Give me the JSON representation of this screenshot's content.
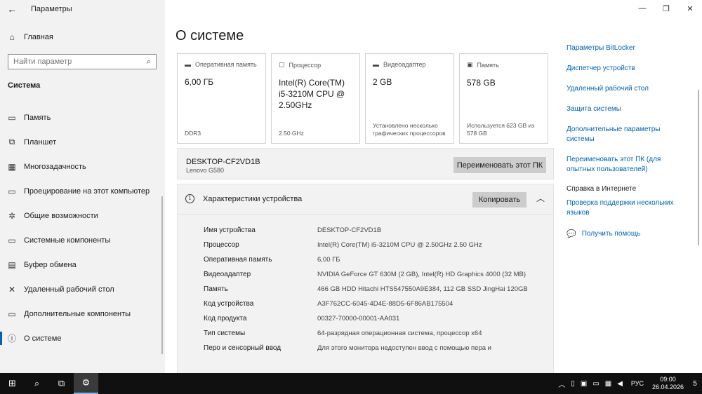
{
  "window": {
    "title": "Параметры",
    "back_icon": "←",
    "minimize_icon": "—",
    "maximize_icon": "❐",
    "close_icon": "✕"
  },
  "sidebar": {
    "home_label": "Главная",
    "search_placeholder": "Найти параметр",
    "section_title": "Система",
    "items": [
      {
        "label": "Память",
        "icon": "▭"
      },
      {
        "label": "Планшет",
        "icon": "⧉"
      },
      {
        "label": "Многозадачность",
        "icon": "▦"
      },
      {
        "label": "Проецирование на этот компьютер",
        "icon": "▭"
      },
      {
        "label": "Общие возможности",
        "icon": "✲"
      },
      {
        "label": "Системные компоненты",
        "icon": "▭"
      },
      {
        "label": "Буфер обмена",
        "icon": "▤"
      },
      {
        "label": "Удаленный рабочий стол",
        "icon": "✕"
      },
      {
        "label": "Дополнительные компоненты",
        "icon": "▭"
      },
      {
        "label": "О системе",
        "icon": "ⓘ"
      }
    ]
  },
  "main": {
    "title": "О системе",
    "cards": [
      {
        "title": "Оперативная память",
        "value": "6,00 ГБ",
        "footer": "DDR3",
        "icon": "▬"
      },
      {
        "title": "Процессор",
        "value": "Intel(R) Core(TM) i5-3210M CPU @ 2.50GHz",
        "footer": "2.50 GHz",
        "icon": "▢"
      },
      {
        "title": "Видеоадаптер",
        "value": "2 GB",
        "footer": "Установлено несколько графических процессоров",
        "icon": "▬"
      },
      {
        "title": "Память",
        "value": "578 GB",
        "footer": "Используется 623 GB из 578 GB",
        "icon": "▣"
      }
    ],
    "device": {
      "name": "DESKTOP-CF2VD1B",
      "model": "Lenovo G580",
      "rename_label": "Переименовать этот ПК"
    },
    "specs": {
      "title": "Характеристики устройства",
      "copy_label": "Копировать",
      "info_icon": "i",
      "chevron_icon": "︿",
      "rows": [
        {
          "label": "Имя устройства",
          "value": "DESKTOP-CF2VD1B"
        },
        {
          "label": "Процессор",
          "value": "Intel(R) Core(TM) i5-3210M CPU @ 2.50GHz   2.50 GHz"
        },
        {
          "label": "Оперативная память",
          "value": "6,00 ГБ"
        },
        {
          "label": "Видеоадаптер",
          "value": "NVIDIA GeForce GT 630M (2 GB), Intel(R) HD Graphics 4000 (32 MB)"
        },
        {
          "label": "Память",
          "value": "466 GB HDD Hitachi HTS547550A9E384, 112 GB SSD JingHai 120GB"
        },
        {
          "label": "Код устройства",
          "value": "A3F762CC-6045-4D4E-88D5-6F86AB175504"
        },
        {
          "label": "Код продукта",
          "value": "00327-70000-00001-AA031"
        },
        {
          "label": "Тип системы",
          "value": "64-разрядная операционная система, процессор x64"
        },
        {
          "label": "Перо и сенсорный ввод",
          "value": "Для этого монитора недоступен ввод с помощью пера и"
        }
      ]
    }
  },
  "related": {
    "links": [
      "Параметры BitLocker",
      "Диспетчер устройств",
      "Удаленный рабочий стол",
      "Защита системы",
      "Дополнительные параметры системы",
      "Переименовать этот ПК (для опытных пользователей)"
    ],
    "help_heading": "Справка в Интернете",
    "help_links": [
      "Проверка поддержки нескольких языков"
    ],
    "get_help": "Получить помощь"
  },
  "taskbar": {
    "start_icon": "⊞",
    "search_icon": "⌕",
    "taskview_icon": "⧉",
    "settings_icon": "⚙",
    "tray": {
      "language": "РУС",
      "time": "09:00",
      "date": "26.04.2026",
      "notification_count": "5"
    }
  }
}
